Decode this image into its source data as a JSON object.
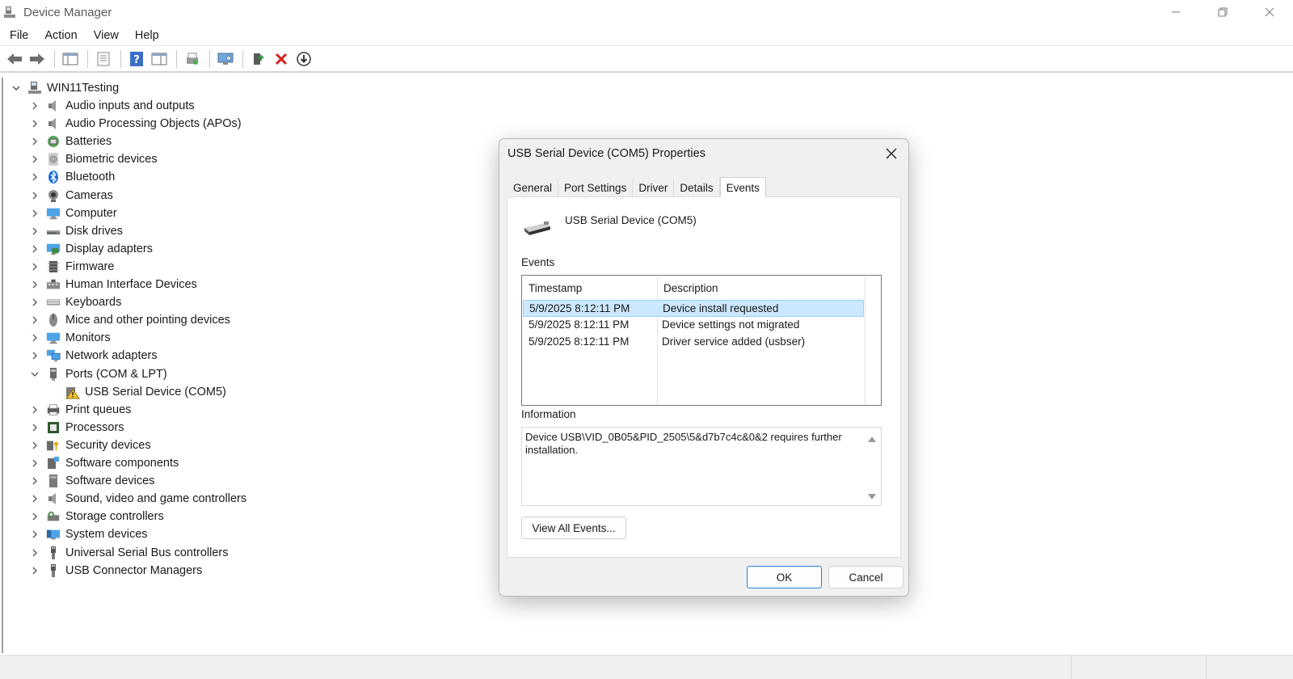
{
  "window": {
    "title": "Device Manager"
  },
  "menu": [
    "File",
    "Action",
    "View",
    "Help"
  ],
  "tree": {
    "root": "WIN11Testing",
    "categories": [
      {
        "label": "Audio inputs and outputs",
        "icon": "speaker-icon"
      },
      {
        "label": "Audio Processing Objects (APOs)",
        "icon": "speaker-icon"
      },
      {
        "label": "Batteries",
        "icon": "battery-icon"
      },
      {
        "label": "Biometric devices",
        "icon": "fingerprint-icon"
      },
      {
        "label": "Bluetooth",
        "icon": "bluetooth-icon"
      },
      {
        "label": "Cameras",
        "icon": "camera-icon"
      },
      {
        "label": "Computer",
        "icon": "monitor-icon"
      },
      {
        "label": "Disk drives",
        "icon": "disk-icon"
      },
      {
        "label": "Display adapters",
        "icon": "display-adapter-icon"
      },
      {
        "label": "Firmware",
        "icon": "chip-icon"
      },
      {
        "label": "Human Interface Devices",
        "icon": "hid-icon"
      },
      {
        "label": "Keyboards",
        "icon": "keyboard-icon"
      },
      {
        "label": "Mice and other pointing devices",
        "icon": "mouse-icon"
      },
      {
        "label": "Monitors",
        "icon": "monitor-icon"
      },
      {
        "label": "Network adapters",
        "icon": "network-icon"
      },
      {
        "label": "Ports (COM & LPT)",
        "icon": "port-icon",
        "expanded": true
      },
      {
        "label": "Print queues",
        "icon": "printer-icon"
      },
      {
        "label": "Processors",
        "icon": "processor-icon"
      },
      {
        "label": "Security devices",
        "icon": "security-icon"
      },
      {
        "label": "Software components",
        "icon": "software-component-icon"
      },
      {
        "label": "Software devices",
        "icon": "software-device-icon"
      },
      {
        "label": "Sound, video and game controllers",
        "icon": "speaker-icon"
      },
      {
        "label": "Storage controllers",
        "icon": "storage-icon"
      },
      {
        "label": "System devices",
        "icon": "system-icon"
      },
      {
        "label": "Universal Serial Bus controllers",
        "icon": "usb-icon"
      },
      {
        "label": "USB Connector Managers",
        "icon": "usb-icon"
      }
    ],
    "child_of_ports": {
      "label": "USB Serial Device (COM5)",
      "icon": "warning-icon"
    }
  },
  "dialog": {
    "title": "USB Serial Device (COM5) Properties",
    "tabs": [
      "General",
      "Port Settings",
      "Driver",
      "Details",
      "Events"
    ],
    "active_tab": "Events",
    "device_name": "USB Serial Device (COM5)",
    "events_label": "Events",
    "columns": [
      "Timestamp",
      "Description"
    ],
    "events": [
      {
        "timestamp": "5/9/2025 8:12:11 PM",
        "description": "Device install requested",
        "selected": true
      },
      {
        "timestamp": "5/9/2025 8:12:11 PM",
        "description": "Device settings not migrated",
        "selected": false
      },
      {
        "timestamp": "5/9/2025 8:12:11 PM",
        "description": "Driver service added (usbser)",
        "selected": false
      }
    ],
    "information_label": "Information",
    "information_text": "Device USB\\VID_0B05&PID_2505\\5&d7b7c4c&0&2 requires further installation.",
    "view_all_label": "View All Events...",
    "ok_label": "OK",
    "cancel_label": "Cancel"
  }
}
